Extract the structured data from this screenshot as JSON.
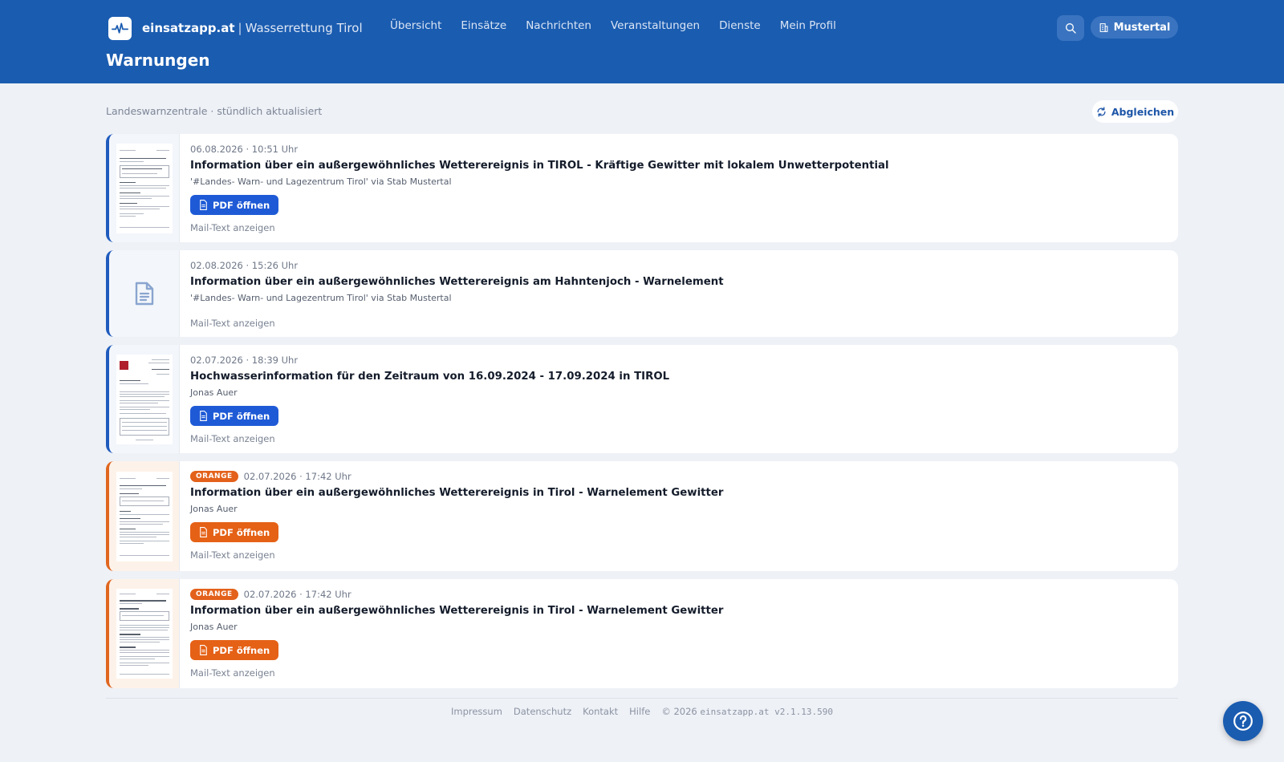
{
  "header": {
    "brand_name": "einsatzapp.at",
    "brand_sep": "|",
    "brand_org": "Wasserrettung Tirol",
    "nav": [
      "Übersicht",
      "Einsätze",
      "Nachrichten",
      "Veranstaltungen",
      "Dienste",
      "Mein Profil"
    ],
    "org_button": "Mustertal",
    "page_title": "Warnungen"
  },
  "toolbar": {
    "subtitle": "Landeswarnzentrale · stündlich aktualisiert",
    "sync_label": "Abgleichen"
  },
  "cards": [
    {
      "badge": "",
      "datetime": "06.08.2026 · 10:51 Uhr",
      "title": "Information über ein außergewöhnliches Wetterereignis in TIROL - Kräftige Gewitter mit lokalem Unwetterpotential",
      "sender": "'#Landes- Warn- und Lagezentrum Tirol' via Stab Mustertal",
      "pdf_label": "PDF öffnen",
      "mail_label": "Mail-Text anzeigen",
      "color": "#1f5bbd"
    },
    {
      "badge": "",
      "datetime": "02.08.2026 · 15:26 Uhr",
      "title": "Information über ein außergewöhnliches Wetterereignis am Hahntenjoch - Warnelement",
      "sender": "'#Landes- Warn- und Lagezentrum Tirol' via Stab Mustertal",
      "pdf_label": "",
      "mail_label": "Mail-Text anzeigen",
      "color": "#1f5bbd"
    },
    {
      "badge": "",
      "datetime": "02.07.2026 · 18:39 Uhr",
      "title": "Hochwasserinformation für den Zeitraum von 16.09.2024 - 17.09.2024 in TIROL",
      "sender": "Jonas Auer",
      "pdf_label": "PDF öffnen",
      "mail_label": "Mail-Text anzeigen",
      "color": "#1f5bbd"
    },
    {
      "badge": "ORANGE",
      "datetime": "02.07.2026 · 17:42 Uhr",
      "title": "Information über ein außergewöhnliches Wetterereignis in Tirol - Warnelement Gewitter",
      "sender": "Jonas Auer",
      "pdf_label": "PDF öffnen",
      "mail_label": "Mail-Text anzeigen",
      "color": "#e0661f"
    },
    {
      "badge": "ORANGE",
      "datetime": "02.07.2026 · 17:42 Uhr",
      "title": "Information über ein außergewöhnliches Wetterereignis in Tirol - Warnelement Gewitter",
      "sender": "Jonas Auer",
      "pdf_label": "PDF öffnen",
      "mail_label": "Mail-Text anzeigen",
      "color": "#e0661f"
    }
  ],
  "footer": {
    "links": [
      "Impressum",
      "Datenschutz",
      "Kontakt",
      "Hilfe"
    ],
    "copyright": "© 2026",
    "version": "einsatzapp.at v2.1.13.590"
  },
  "icons": {
    "logo": "pulse-icon",
    "search": "search-icon",
    "org": "building-icon",
    "sync": "refresh-icon",
    "pdf": "document-icon",
    "help": "question-icon"
  }
}
